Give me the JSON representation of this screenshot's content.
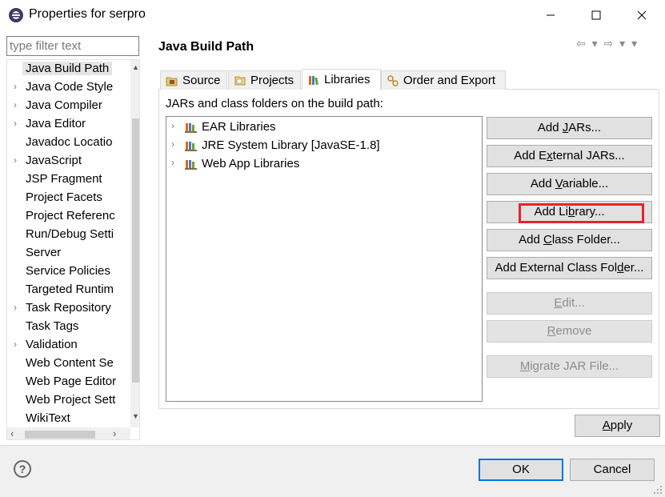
{
  "window": {
    "title": "Properties for serpro",
    "minimize_glyph": "—",
    "maximize_glyph": "☐",
    "close_glyph": "✕"
  },
  "filter": {
    "placeholder": "type filter text",
    "value": ""
  },
  "nav": {
    "items": [
      {
        "label": "Java Build Path",
        "expandable": false,
        "selected": true
      },
      {
        "label": "Java Code Style",
        "expandable": true
      },
      {
        "label": "Java Compiler",
        "expandable": true
      },
      {
        "label": "Java Editor",
        "expandable": true
      },
      {
        "label": "Javadoc Locatio",
        "expandable": false
      },
      {
        "label": "JavaScript",
        "expandable": true
      },
      {
        "label": "JSP Fragment",
        "expandable": false
      },
      {
        "label": "Project Facets",
        "expandable": false
      },
      {
        "label": "Project Referenc",
        "expandable": false
      },
      {
        "label": "Run/Debug Setti",
        "expandable": false
      },
      {
        "label": "Server",
        "expandable": false
      },
      {
        "label": "Service Policies",
        "expandable": false
      },
      {
        "label": "Targeted Runtim",
        "expandable": false
      },
      {
        "label": "Task Repository",
        "expandable": true
      },
      {
        "label": "Task Tags",
        "expandable": false
      },
      {
        "label": "Validation",
        "expandable": true
      },
      {
        "label": "Web Content Se",
        "expandable": false
      },
      {
        "label": "Web Page Editor",
        "expandable": false
      },
      {
        "label": "Web Project Sett",
        "expandable": false
      },
      {
        "label": "WikiText",
        "expandable": false
      }
    ]
  },
  "page": {
    "title": "Java Build Path",
    "nav_arrows": "⇦ ▾ ⇨ ▾ ▾",
    "tabs": [
      {
        "label": "Source",
        "icon": "source-folder-icon"
      },
      {
        "label": "Projects",
        "icon": "projects-icon"
      },
      {
        "label": "Libraries",
        "icon": "libraries-icon",
        "active": true
      },
      {
        "label": "Order and Export",
        "icon": "order-export-icon"
      }
    ],
    "libraries_label": "JARs and class folders on the build path:",
    "libraries": [
      {
        "label": "EAR Libraries"
      },
      {
        "label": "JRE System Library [JavaSE-1.8]"
      },
      {
        "label": "Web App Libraries"
      }
    ],
    "buttons": {
      "add_jars": {
        "pre": "Add ",
        "mn": "J",
        "post": "ARs..."
      },
      "add_external_jars": {
        "pre": "Add E",
        "mn": "x",
        "post": "ternal JARs..."
      },
      "add_variable": {
        "pre": "Add ",
        "mn": "V",
        "post": "ariable..."
      },
      "add_library": {
        "pre": "Add Li",
        "mn": "b",
        "post": "rary..."
      },
      "add_class_folder": {
        "pre": "Add ",
        "mn": "C",
        "post": "lass Folder..."
      },
      "add_external_class_folder": {
        "pre": "Add External Class Fol",
        "mn": "d",
        "post": "er..."
      },
      "edit": {
        "pre": "",
        "mn": "E",
        "post": "dit..."
      },
      "remove": {
        "pre": "",
        "mn": "R",
        "post": "emove"
      },
      "migrate": {
        "pre": "",
        "mn": "M",
        "post": "igrate JAR File..."
      }
    },
    "apply": {
      "pre": "",
      "mn": "A",
      "post": "pply"
    }
  },
  "footer": {
    "help_glyph": "?",
    "ok_label": "OK",
    "cancel_label": "Cancel"
  },
  "colors": {
    "highlight": "#e8232b",
    "default_button_border": "#0078d7"
  }
}
